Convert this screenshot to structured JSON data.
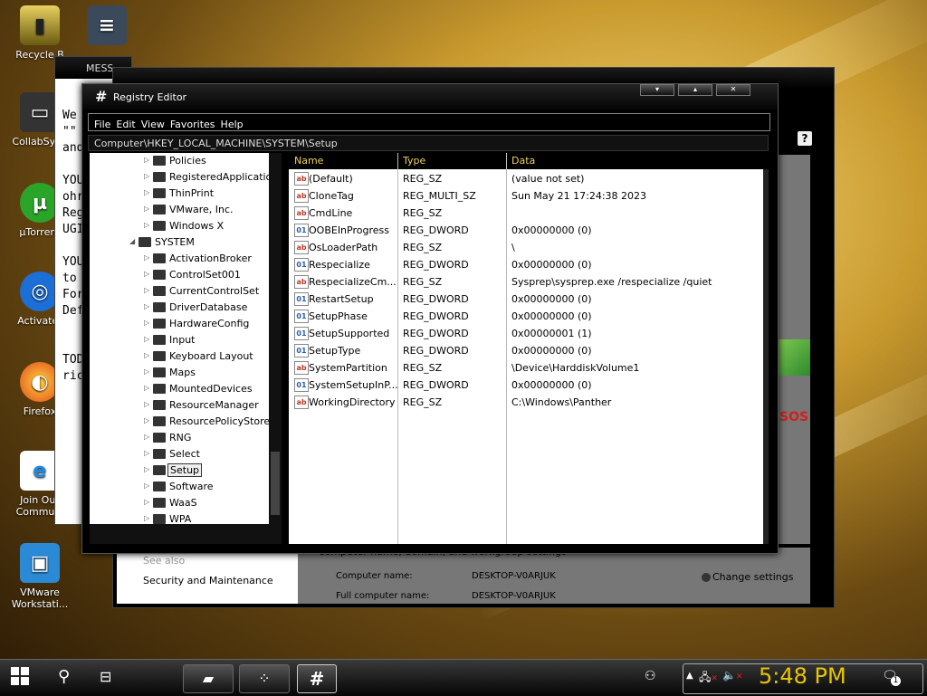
{
  "desktop_icons": [
    {
      "label": "Recycle B",
      "icon": "recycle-bin-icon"
    },
    {
      "label": "CollabSysC",
      "icon": "folder-icon"
    },
    {
      "label": "µTorrent",
      "icon": "utorrent-icon"
    },
    {
      "label": "Activater",
      "icon": "activator-icon"
    },
    {
      "label": "Firefox",
      "icon": "firefox-icon"
    },
    {
      "label": "Join Our Communi",
      "icon": "internet-explorer-icon"
    },
    {
      "label": "VMware Workstati...",
      "icon": "vmware-icon"
    }
  ],
  "bg_window": {
    "title": "MESS",
    "text_lines": [
      "We",
      "\"\"",
      "and",
      "",
      "YOU",
      "ohr",
      "Reg",
      "UGI",
      "",
      "YOU",
      "to",
      "For",
      "Def",
      "",
      "",
      "TOD",
      "ric"
    ]
  },
  "control_panel": {
    "see_also": "See also",
    "security": "Security and Maintenance",
    "heading": "Computer name, domain, and workgroup settings",
    "computer_name_label": "Computer name:",
    "computer_name": "DESKTOP-V0ARJUK",
    "full_name_label": "Full computer name:",
    "full_name": "DESKTOP-V0ARJUK",
    "change_settings": "Change settings",
    "brand": "SOS"
  },
  "registry": {
    "title": "Registry Editor",
    "menu": [
      "File",
      "Edit",
      "View",
      "Favorites",
      "Help"
    ],
    "address": "Computer\\HKEY_LOCAL_MACHINE\\SYSTEM\\Setup",
    "columns": {
      "name": "Name",
      "type": "Type",
      "data": "Data"
    },
    "tree": [
      {
        "label": "Policies",
        "level": 1
      },
      {
        "label": "RegisteredApplications",
        "level": 1
      },
      {
        "label": "ThinPrint",
        "level": 1
      },
      {
        "label": "VMware, Inc.",
        "level": 1
      },
      {
        "label": "Windows X",
        "level": 1
      },
      {
        "label": "SYSTEM",
        "level": 0
      },
      {
        "label": "ActivationBroker",
        "level": 1
      },
      {
        "label": "ControlSet001",
        "level": 1
      },
      {
        "label": "CurrentControlSet",
        "level": 1
      },
      {
        "label": "DriverDatabase",
        "level": 1
      },
      {
        "label": "HardwareConfig",
        "level": 1
      },
      {
        "label": "Input",
        "level": 1
      },
      {
        "label": "Keyboard Layout",
        "level": 1
      },
      {
        "label": "Maps",
        "level": 1
      },
      {
        "label": "MountedDevices",
        "level": 1
      },
      {
        "label": "ResourceManager",
        "level": 1
      },
      {
        "label": "ResourcePolicyStore",
        "level": 1
      },
      {
        "label": "RNG",
        "level": 1
      },
      {
        "label": "Select",
        "level": 1
      },
      {
        "label": "Setup",
        "level": 1
      },
      {
        "label": "Software",
        "level": 1
      },
      {
        "label": "WaaS",
        "level": 1
      },
      {
        "label": "WPA",
        "level": 1
      }
    ],
    "values": [
      {
        "name": "(Default)",
        "type": "REG_SZ",
        "data": "(value not set)",
        "icon": "ab"
      },
      {
        "name": "CloneTag",
        "type": "REG_MULTI_SZ",
        "data": "Sun May 21 17:24:38 2023",
        "icon": "ab"
      },
      {
        "name": "CmdLine",
        "type": "REG_SZ",
        "data": "",
        "icon": "ab"
      },
      {
        "name": "OOBEInProgress",
        "type": "REG_DWORD",
        "data": "0x00000000 (0)",
        "icon": "bin"
      },
      {
        "name": "OsLoaderPath",
        "type": "REG_SZ",
        "data": "\\",
        "icon": "ab"
      },
      {
        "name": "Respecialize",
        "type": "REG_DWORD",
        "data": "0x00000000 (0)",
        "icon": "bin"
      },
      {
        "name": "RespecializeCm...",
        "type": "REG_SZ",
        "data": "Sysprep\\sysprep.exe /respecialize /quiet",
        "icon": "ab"
      },
      {
        "name": "RestartSetup",
        "type": "REG_DWORD",
        "data": "0x00000000 (0)",
        "icon": "bin"
      },
      {
        "name": "SetupPhase",
        "type": "REG_DWORD",
        "data": "0x00000000 (0)",
        "icon": "bin"
      },
      {
        "name": "SetupSupported",
        "type": "REG_DWORD",
        "data": "0x00000001 (1)",
        "icon": "bin"
      },
      {
        "name": "SetupType",
        "type": "REG_DWORD",
        "data": "0x00000000 (0)",
        "icon": "bin"
      },
      {
        "name": "SystemPartition",
        "type": "REG_SZ",
        "data": "\\Device\\HarddiskVolume1",
        "icon": "ab"
      },
      {
        "name": "SystemSetupInP...",
        "type": "REG_DWORD",
        "data": "0x00000000 (0)",
        "icon": "bin"
      },
      {
        "name": "WorkingDirectory",
        "type": "REG_SZ",
        "data": "C:\\Windows\\Panther",
        "icon": "ab"
      }
    ]
  },
  "taskbar": {
    "clock": "5:48 PM",
    "notification_count": "1",
    "task_regedit_glyph": "#"
  },
  "colors": {
    "clock": "#e8c500",
    "column_header_text": "#f0d060"
  }
}
